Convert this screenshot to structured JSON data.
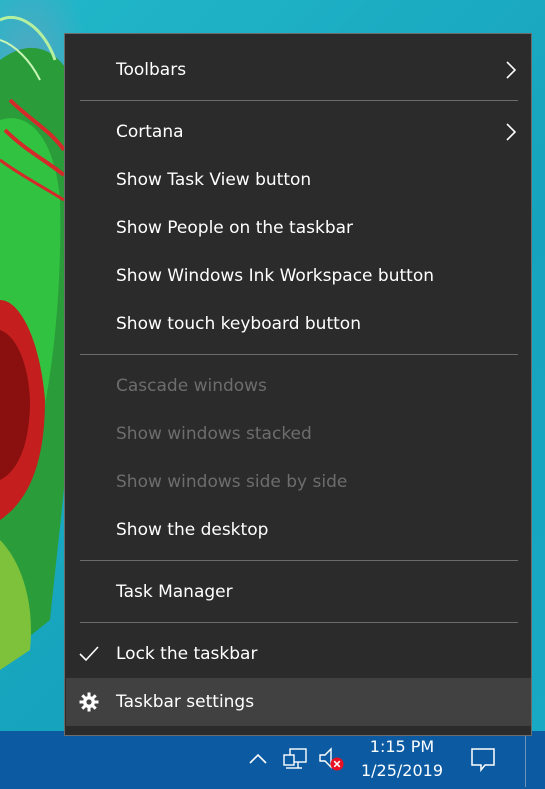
{
  "context_menu": {
    "items": [
      {
        "label": "Toolbars"
      },
      {
        "label": "Cortana"
      },
      {
        "label": "Show Task View button"
      },
      {
        "label": "Show People on the taskbar"
      },
      {
        "label": "Show Windows Ink Workspace button"
      },
      {
        "label": "Show touch keyboard button"
      },
      {
        "label": "Cascade windows"
      },
      {
        "label": "Show windows stacked"
      },
      {
        "label": "Show windows side by side"
      },
      {
        "label": "Show the desktop"
      },
      {
        "label": "Task Manager"
      },
      {
        "label": "Lock the taskbar"
      },
      {
        "label": "Taskbar settings"
      }
    ]
  },
  "taskbar": {
    "time": "1:15 PM",
    "date": "1/25/2019"
  },
  "colors": {
    "menu_background": "#2b2b2b",
    "menu_hover": "#414141",
    "disabled_text": "#6d6d6d",
    "taskbar": "#0b5aa2"
  },
  "icons": {
    "submenu": "chevron-right-icon",
    "checked": "checkmark-icon",
    "settings": "gear-icon",
    "tray_overflow": "chevron-up-icon",
    "network": "network-icon",
    "volume": "volume-muted-icon",
    "notifications": "action-center-icon"
  }
}
